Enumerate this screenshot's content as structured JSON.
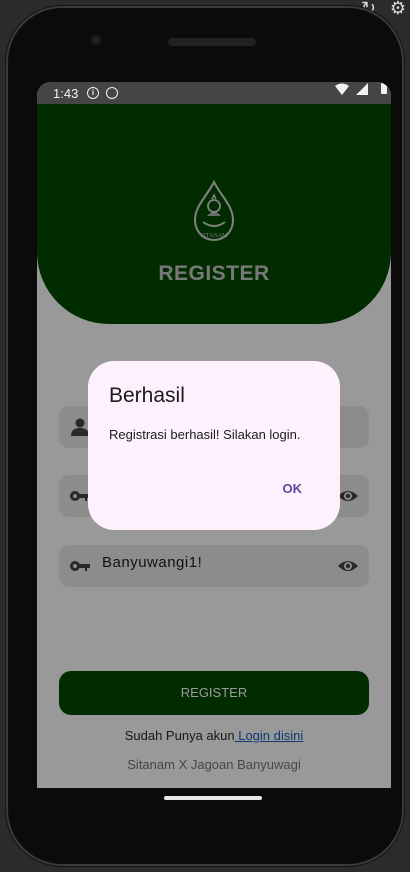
{
  "statusbar": {
    "time": "1:43",
    "info_glyph": "i"
  },
  "header": {
    "logo_caption": "SITANAM",
    "title": "REGISTER"
  },
  "form": {
    "fields": [
      {
        "icon": "person-icon",
        "value": ""
      },
      {
        "icon": "key-icon",
        "value": ""
      },
      {
        "icon": "key-icon",
        "value": "Banyuwangi1!"
      }
    ]
  },
  "actions": {
    "register_label": "REGISTER",
    "login_prompt": "Sudah Punya akun",
    "login_link": " Login disini"
  },
  "footer": {
    "text": "Sitanam X Jagoan Banyuwagi"
  },
  "dialog": {
    "title": "Berhasil",
    "message": "Registrasi berhasil! Silakan login.",
    "ok_label": "OK"
  },
  "colors": {
    "header_green": "#004a00",
    "dialog_bg": "#fcf1fd",
    "dialog_action": "#5b4a9e",
    "link": "#1565c0"
  }
}
